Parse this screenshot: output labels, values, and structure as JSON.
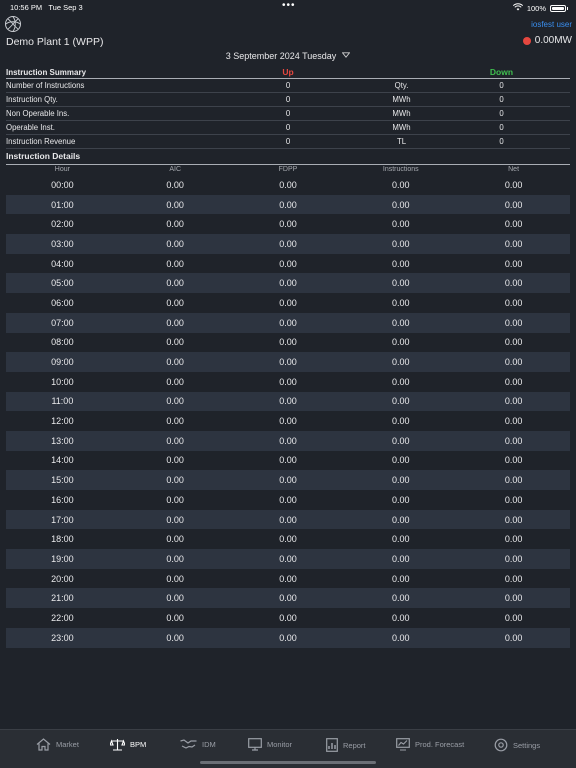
{
  "status_bar": {
    "time": "10:56 PM",
    "date": "Tue Sep 3",
    "battery": "100%"
  },
  "header": {
    "plant": "Demo Plant 1 (WPP)",
    "user": "iosfest user",
    "power": "0.00MW"
  },
  "date": "3 September 2024 Tuesday",
  "summary": {
    "title": "Instruction Summary",
    "up_label": "Up",
    "down_label": "Down",
    "rows": [
      {
        "label": "Number of Instructions",
        "up": "0",
        "unit": "Qty.",
        "down": "0"
      },
      {
        "label": "Instruction Qty.",
        "up": "0",
        "unit": "MWh",
        "down": "0"
      },
      {
        "label": "Non Operable Ins.",
        "up": "0",
        "unit": "MWh",
        "down": "0"
      },
      {
        "label": "Operable Inst.",
        "up": "0",
        "unit": "MWh",
        "down": "0"
      },
      {
        "label": "Instruction Revenue",
        "up": "0",
        "unit": "TL",
        "down": "0"
      }
    ]
  },
  "details": {
    "title": "Instruction Details",
    "columns": [
      "Hour",
      "AIC",
      "FDPP",
      "Instructions",
      "Net"
    ],
    "rows": [
      [
        "00:00",
        "0.00",
        "0.00",
        "0.00",
        "0.00"
      ],
      [
        "01:00",
        "0.00",
        "0.00",
        "0.00",
        "0.00"
      ],
      [
        "02:00",
        "0.00",
        "0.00",
        "0.00",
        "0.00"
      ],
      [
        "03:00",
        "0.00",
        "0.00",
        "0.00",
        "0.00"
      ],
      [
        "04:00",
        "0.00",
        "0.00",
        "0.00",
        "0.00"
      ],
      [
        "05:00",
        "0.00",
        "0.00",
        "0.00",
        "0.00"
      ],
      [
        "06:00",
        "0.00",
        "0.00",
        "0.00",
        "0.00"
      ],
      [
        "07:00",
        "0.00",
        "0.00",
        "0.00",
        "0.00"
      ],
      [
        "08:00",
        "0.00",
        "0.00",
        "0.00",
        "0.00"
      ],
      [
        "09:00",
        "0.00",
        "0.00",
        "0.00",
        "0.00"
      ],
      [
        "10:00",
        "0.00",
        "0.00",
        "0.00",
        "0.00"
      ],
      [
        "11:00",
        "0.00",
        "0.00",
        "0.00",
        "0.00"
      ],
      [
        "12:00",
        "0.00",
        "0.00",
        "0.00",
        "0.00"
      ],
      [
        "13:00",
        "0.00",
        "0.00",
        "0.00",
        "0.00"
      ],
      [
        "14:00",
        "0.00",
        "0.00",
        "0.00",
        "0.00"
      ],
      [
        "15:00",
        "0.00",
        "0.00",
        "0.00",
        "0.00"
      ],
      [
        "16:00",
        "0.00",
        "0.00",
        "0.00",
        "0.00"
      ],
      [
        "17:00",
        "0.00",
        "0.00",
        "0.00",
        "0.00"
      ],
      [
        "18:00",
        "0.00",
        "0.00",
        "0.00",
        "0.00"
      ],
      [
        "19:00",
        "0.00",
        "0.00",
        "0.00",
        "0.00"
      ],
      [
        "20:00",
        "0.00",
        "0.00",
        "0.00",
        "0.00"
      ],
      [
        "21:00",
        "0.00",
        "0.00",
        "0.00",
        "0.00"
      ],
      [
        "22:00",
        "0.00",
        "0.00",
        "0.00",
        "0.00"
      ],
      [
        "23:00",
        "0.00",
        "0.00",
        "0.00",
        "0.00"
      ]
    ]
  },
  "tabs": [
    {
      "label": "Market",
      "icon": "home-icon",
      "active": false
    },
    {
      "label": "BPM",
      "icon": "scale-icon",
      "active": true
    },
    {
      "label": "IDM",
      "icon": "handshake-icon",
      "active": false
    },
    {
      "label": "Monitor",
      "icon": "monitor-icon",
      "active": false
    },
    {
      "label": "Report",
      "icon": "report-icon",
      "active": false
    },
    {
      "label": "Prod. Forecast",
      "icon": "forecast-icon",
      "active": false
    },
    {
      "label": "Settings",
      "icon": "gear-icon",
      "active": false
    }
  ],
  "colors": {
    "up": "#e5473f",
    "down": "#3fbf4f",
    "link": "#3a8ff0",
    "background": "#1f232a",
    "row_alt": "#2d3440"
  }
}
